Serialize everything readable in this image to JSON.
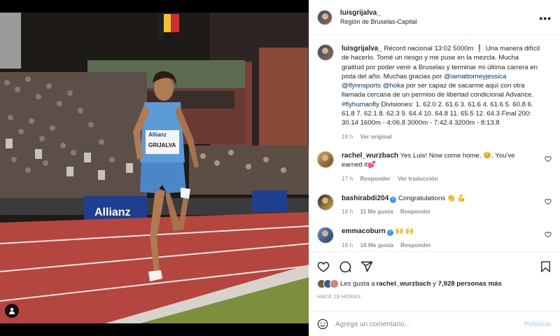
{
  "post": {
    "username": "luisgrijalva_",
    "location": "Región de Bruselas-Capital",
    "more_icon": "more-horizontal-icon",
    "photo": {
      "bib_name": "GRIJALVA",
      "sponsor": "Allianz",
      "banner_text": "Allianz",
      "jersey_color": "#5b9bd8",
      "track_color": "#b5463f"
    }
  },
  "caption": {
    "username": "luisgrijalva_",
    "text_before": " Récord nacional 13:02 5000m ❗️ Una manera difícil de hacerlo. Tomé un riesgo y me puse en la mezcla. Mucha gratitud por poder venir a Bruselas y terminar mi última carrera en pista del año. Muchas gracias por ",
    "mention1": "@iamattorneyjessica",
    "space1": " ",
    "mention2": "@flynnsports",
    "space2": " ",
    "mention3": "@hoka",
    "text_middle": " por ser capaz de sacarme aquí con otra llamada cercana de un permiso de libertad condicional Advance. ",
    "hashtag": "#flyhumanfly",
    "text_after": " Divisiones: 1. 62.0 2. 61.6 3. 61.6 4. 61.6 5. 60.8 6. 61.8 7. 62.1 8. 62.3 9. 64.4 10. 64.8 11. 65.5 12. 64.3 Final 200: 30.14 1600m - 4:06.8 3000m - 7:42.4 3200m - 8:13.8",
    "time": "18 h",
    "see_original": "Ver original"
  },
  "comments": [
    {
      "username": "rachel_wurzbach",
      "text": " Yes Luis! Now come home. 😊. You've earned it💕",
      "time": "17 h",
      "reply": "Responder",
      "translate": "Ver traducción",
      "likes": ""
    },
    {
      "username": "bashirabdi204",
      "verified": true,
      "text": " Congratulations 👏 💪",
      "time": "18 h",
      "likes": "11 Me gusta",
      "reply": "Responder"
    },
    {
      "username": "emmacoburn",
      "verified": true,
      "text": " 🙌 🙌",
      "time": "18 h",
      "likes": "16 Me gusta",
      "reply": "Responder"
    }
  ],
  "actions": {
    "likes_prefix": "Les gusta a ",
    "liked_by": "rachel_wurzbach",
    "likes_and": " y ",
    "likes_count": "7,928 personas más",
    "posted_ago": "HACE 18 HORAS"
  },
  "composer": {
    "placeholder": "Agrega un comentario...",
    "publish_label": "Publicar"
  },
  "colors": {
    "link": "#00376b",
    "publish_disabled": "#b2dffc",
    "verified": "#3897f0"
  }
}
